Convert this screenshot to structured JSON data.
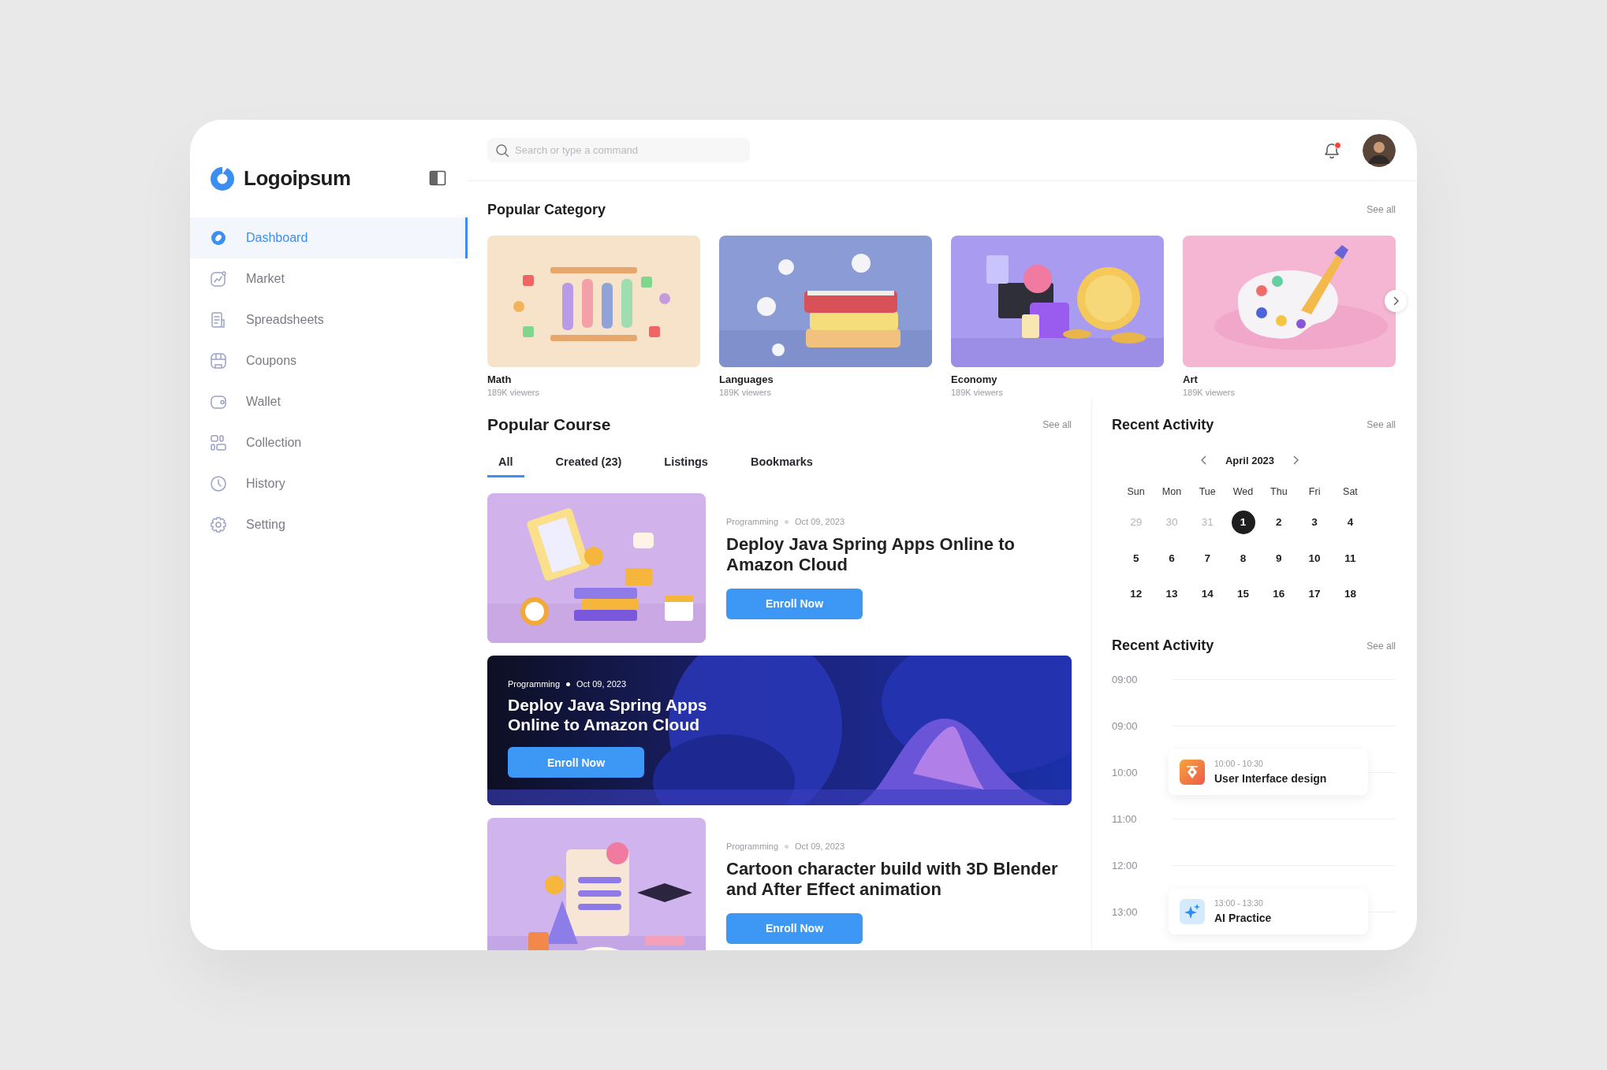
{
  "brand": {
    "name": "Logoipsum"
  },
  "sidebar": {
    "items": [
      {
        "label": "Dashboard",
        "selected": true
      },
      {
        "label": "Market",
        "selected": false
      },
      {
        "label": "Spreadsheets",
        "selected": false
      },
      {
        "label": "Coupons",
        "selected": false
      },
      {
        "label": "Wallet",
        "selected": false
      },
      {
        "label": "Collection",
        "selected": false
      },
      {
        "label": "History",
        "selected": false
      },
      {
        "label": "Setting",
        "selected": false
      }
    ]
  },
  "search": {
    "placeholder": "Search or type a command"
  },
  "notifications": {
    "unread": true
  },
  "popular_category": {
    "title": "Popular Category",
    "see_all": "See all",
    "items": [
      {
        "name": "Math",
        "viewers": "189K viewers"
      },
      {
        "name": "Languages",
        "viewers": "189K viewers"
      },
      {
        "name": "Economy",
        "viewers": "189K viewers"
      },
      {
        "name": "Art",
        "viewers": "189K viewers"
      }
    ]
  },
  "popular_course": {
    "title": "Popular Course",
    "see_all": "See all",
    "tabs": [
      {
        "label": "All",
        "selected": true
      },
      {
        "label": "Created (23)",
        "selected": false
      },
      {
        "label": "Listings",
        "selected": false
      },
      {
        "label": "Bookmarks",
        "selected": false
      }
    ],
    "courses": [
      {
        "kind": "row",
        "category": "Programming",
        "date": "Oct 09, 2023",
        "title": "Deploy Java Spring Apps Online to Amazon Cloud",
        "button": "Enroll Now"
      },
      {
        "kind": "banner",
        "category": "Programming",
        "date": "Oct 09, 2023",
        "title": "Deploy Java Spring Apps Online to Amazon Cloud",
        "button": "Enroll Now"
      },
      {
        "kind": "row",
        "category": "Programming",
        "date": "Oct 09, 2023",
        "title": "Cartoon character build with 3D Blender and After Effect animation",
        "button": "Enroll Now"
      }
    ]
  },
  "calendar": {
    "title": "Recent Activity",
    "see_all": "See all",
    "month": "April 2023",
    "weekdays": [
      "Sun",
      "Mon",
      "Tue",
      "Wed",
      "Thu",
      "Fri",
      "Sat"
    ],
    "days": [
      {
        "label": "29",
        "muted": true,
        "selected": false
      },
      {
        "label": "30",
        "muted": true,
        "selected": false
      },
      {
        "label": "31",
        "muted": true,
        "selected": false
      },
      {
        "label": "1",
        "muted": false,
        "selected": true
      },
      {
        "label": "2",
        "muted": false,
        "selected": false
      },
      {
        "label": "3",
        "muted": false,
        "selected": false
      },
      {
        "label": "4",
        "muted": false,
        "selected": false
      },
      {
        "label": "5",
        "muted": false,
        "selected": false
      },
      {
        "label": "6",
        "muted": false,
        "selected": false
      },
      {
        "label": "7",
        "muted": false,
        "selected": false
      },
      {
        "label": "8",
        "muted": false,
        "selected": false
      },
      {
        "label": "9",
        "muted": false,
        "selected": false
      },
      {
        "label": "10",
        "muted": false,
        "selected": false
      },
      {
        "label": "11",
        "muted": false,
        "selected": false
      },
      {
        "label": "12",
        "muted": false,
        "selected": false
      },
      {
        "label": "13",
        "muted": false,
        "selected": false
      },
      {
        "label": "14",
        "muted": false,
        "selected": false
      },
      {
        "label": "15",
        "muted": false,
        "selected": false
      },
      {
        "label": "16",
        "muted": false,
        "selected": false
      },
      {
        "label": "17",
        "muted": false,
        "selected": false
      },
      {
        "label": "18",
        "muted": false,
        "selected": false
      }
    ]
  },
  "schedule": {
    "title": "Recent Activity",
    "see_all": "See all",
    "slots": [
      {
        "time": "09:00"
      },
      {
        "time": "09:00"
      },
      {
        "time": "10:00",
        "event": {
          "time_range": "10:00 - 10:30",
          "title": "User Interface design"
        }
      },
      {
        "time": "11:00"
      },
      {
        "time": "12:00"
      },
      {
        "time": "13:00",
        "event": {
          "time_range": "13:00 - 13:30",
          "title": "AI Practice"
        }
      }
    ]
  }
}
